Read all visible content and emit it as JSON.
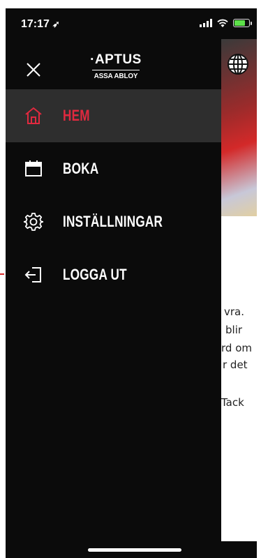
{
  "status_bar": {
    "time": "17:17",
    "battery_fill_fraction": 0.7,
    "battery_color": "#5de04a"
  },
  "drawer": {
    "logo": {
      "brand": "·APTUS",
      "sub": "ASSA ABLOY"
    },
    "close_icon": "close-icon",
    "items": [
      {
        "label": "HEM",
        "icon": "home-icon",
        "active": true
      },
      {
        "label": "BOKA",
        "icon": "calendar-icon",
        "active": false
      },
      {
        "label": "INSTÄLLNINGAR",
        "icon": "gear-icon",
        "active": false
      },
      {
        "label": "LOGGA UT",
        "icon": "logout-icon",
        "active": false
      }
    ],
    "accent_color": "#e0293f"
  },
  "background_page": {
    "globe_icon": "globe-icon",
    "text_fragments": [
      "vra.",
      "blir",
      "rd om",
      "r det",
      "Tack"
    ]
  }
}
